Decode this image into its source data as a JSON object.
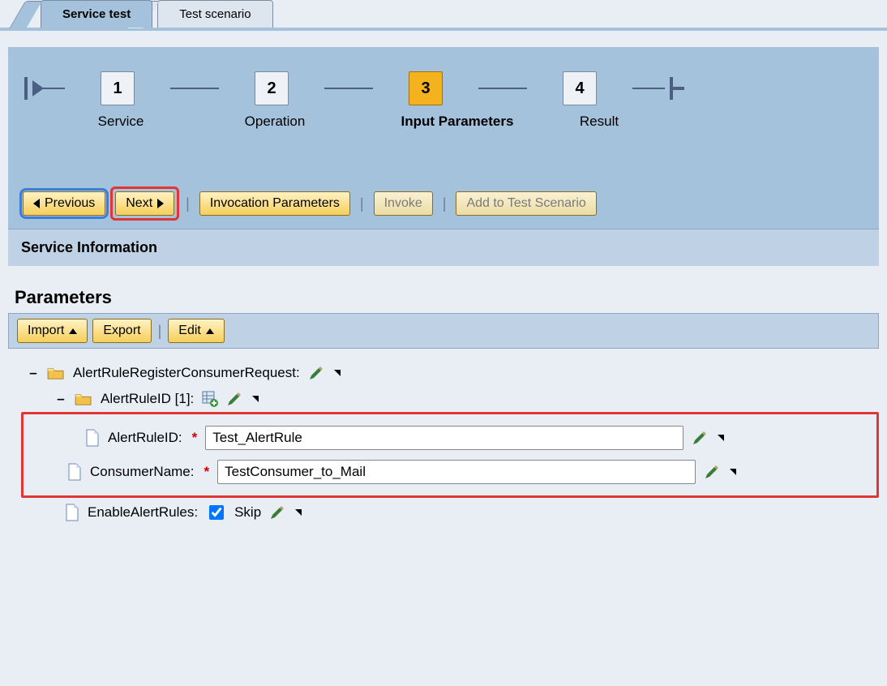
{
  "tabs": {
    "service_test": "Service test",
    "test_scenario": "Test scenario",
    "active": 0
  },
  "roadmap": {
    "steps": [
      {
        "num": "1",
        "label": "Service"
      },
      {
        "num": "2",
        "label": "Operation"
      },
      {
        "num": "3",
        "label": "Input Parameters"
      },
      {
        "num": "4",
        "label": "Result"
      }
    ],
    "current": 2
  },
  "toolbar": {
    "previous": "Previous",
    "next": "Next",
    "invocation_params": "Invocation Parameters",
    "invoke": "Invoke",
    "add_to_scenario": "Add to Test Scenario"
  },
  "section": {
    "service_info": "Service Information"
  },
  "parameters": {
    "title": "Parameters",
    "buttons": {
      "import": "Import",
      "export": "Export",
      "edit": "Edit"
    },
    "tree": {
      "root_label": "AlertRuleRegisterConsumerRequest:",
      "child_label": "AlertRuleID [1]:",
      "fields": {
        "alert_rule_id": {
          "label": "AlertRuleID:",
          "value": "Test_AlertRule",
          "required": true
        },
        "consumer_name": {
          "label": "ConsumerName:",
          "value": "TestConsumer_to_Mail",
          "required": true
        },
        "enable_alert_rules": {
          "label": "EnableAlertRules:",
          "skip_label": "Skip",
          "skip_checked": true
        }
      }
    }
  }
}
